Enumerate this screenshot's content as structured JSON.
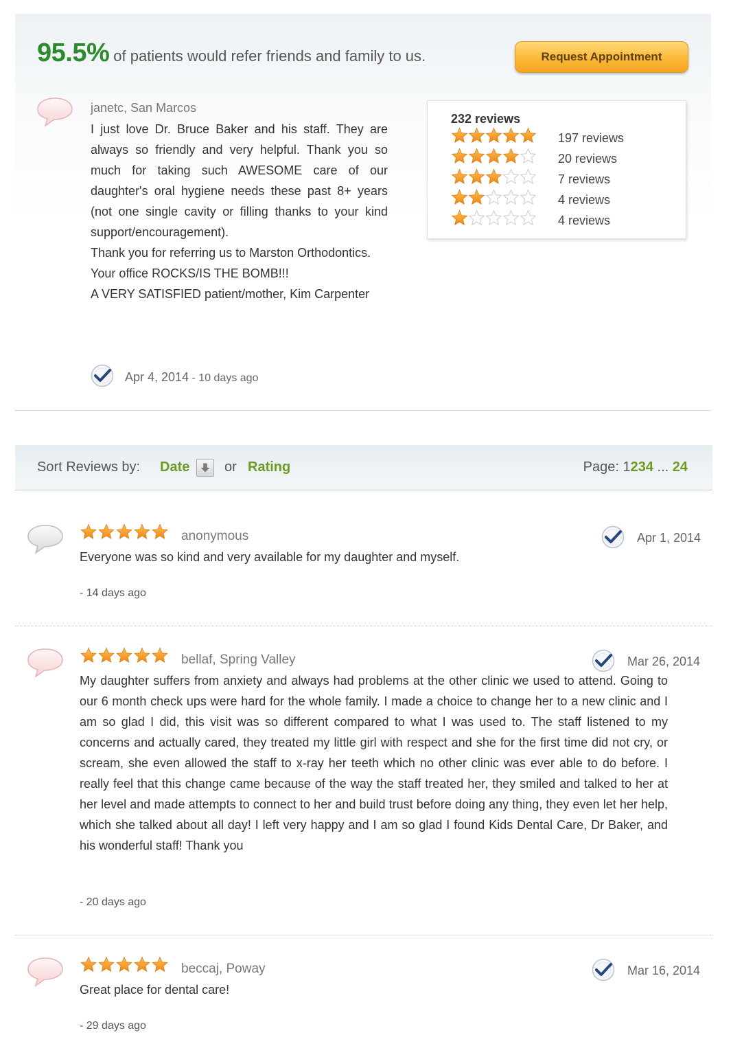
{
  "header": {
    "percent": "95.5%",
    "tagline": "of patients would refer friends and family to us.",
    "request_button": "Request Appointment"
  },
  "featured": {
    "author": "janetc, San Marcos",
    "paragraphs": [
      "I just love Dr. Bruce Baker and his staff. They are always so friendly and very helpful. Thank you so much for taking such AWESOME care of our daughter's oral hygiene needs these past 8+ years (not one single cavity or filling thanks to your kind support/encouragement).",
      "Thank you for referring us to Marston Orthodontics.",
      "Your office ROCKS/IS THE BOMB!!!",
      "A VERY SATISFIED patient/mother, Kim Carpenter"
    ],
    "date": "Apr 4, 2014",
    "ago": " - 10 days ago"
  },
  "summary": {
    "total": "232 reviews",
    "rows": [
      {
        "stars": 5,
        "count": "197 reviews"
      },
      {
        "stars": 4,
        "count": "20 reviews"
      },
      {
        "stars": 3,
        "count": "7 reviews"
      },
      {
        "stars": 2,
        "count": "4 reviews"
      },
      {
        "stars": 1,
        "count": "4 reviews"
      }
    ]
  },
  "sort": {
    "label": "Sort Reviews by:",
    "date": "Date",
    "or": "or",
    "rating": "Rating",
    "page_label": "Page:",
    "pages": [
      "1",
      "2",
      "3",
      "4"
    ],
    "ellipsis": "...",
    "last_page": "24"
  },
  "reviews": [
    {
      "stars": 5,
      "author": "anonymous",
      "date": "Apr 1, 2014",
      "body": "Everyone was so kind and very available for my daughter and myself.",
      "ago": "- 14 days ago",
      "bubble": "gray"
    },
    {
      "stars": 5,
      "author": "bellaf, Spring Valley",
      "date": "Mar 26, 2014",
      "body": "My daughter suffers from anxiety and always had problems at the other clinic we used to attend. Going to our 6 month check ups were hard for the whole family. I made a choice to change her to a new clinic and I am so glad I did, this visit was so different compared to what I was used to. The staff listened to my concerns and actually cared, they treated my little girl with respect and she for the first time did not cry, or scream, she even allowed the staff to x-ray her teeth which no other clinic was ever able to do before. I really feel that this change came because of the way the staff treated her, they smiled and talked to her at her level and made attempts to connect to her and build trust before doing any thing, they even let her help, which she talked about all day! I left very happy and I am so glad I found Kids Dental Care, Dr Baker, and his wonderful staff! Thank you",
      "ago": "- 20 days ago",
      "bubble": "pink"
    },
    {
      "stars": 5,
      "author": "beccaj, Poway",
      "date": "Mar 16, 2014",
      "body": "Great place for dental care!",
      "ago": "- 29 days ago",
      "bubble": "pink"
    }
  ],
  "colors": {
    "accent_green": "#2c8c2c",
    "link_green": "#6d9a1f",
    "star_orange": "#f7941d",
    "button_orange": "#fbb937"
  },
  "icons": {
    "bubble": "speech-bubble-icon",
    "verified": "verified-check-icon",
    "sort_arrow": "sort-down-arrow-icon",
    "star": "star-icon"
  }
}
